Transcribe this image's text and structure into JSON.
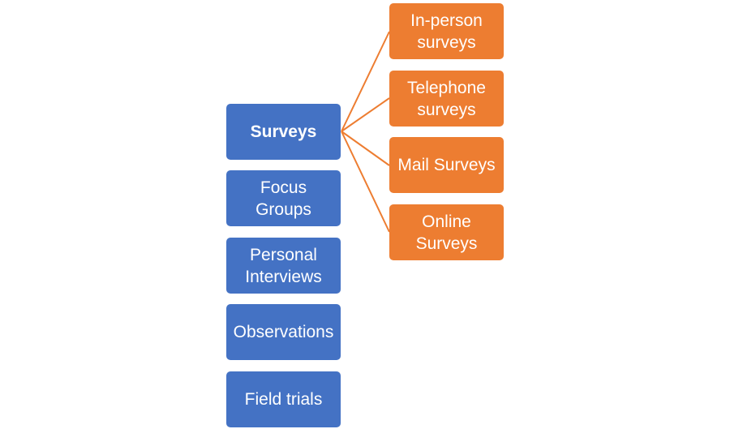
{
  "diagram": {
    "colors": {
      "primary": "#4472c4",
      "secondary": "#ed7d31",
      "connector": "#ed7d31"
    },
    "primary_items": [
      {
        "label": "Surveys",
        "emphasized": true
      },
      {
        "label": "Focus Groups"
      },
      {
        "label": "Personal Interviews"
      },
      {
        "label": "Observations"
      },
      {
        "label": "Field trials"
      }
    ],
    "secondary_items": [
      {
        "label": "In-person surveys"
      },
      {
        "label": "Telephone surveys"
      },
      {
        "label": "Mail Surveys"
      },
      {
        "label": "Online Surveys"
      }
    ],
    "connections_from": "Surveys"
  }
}
